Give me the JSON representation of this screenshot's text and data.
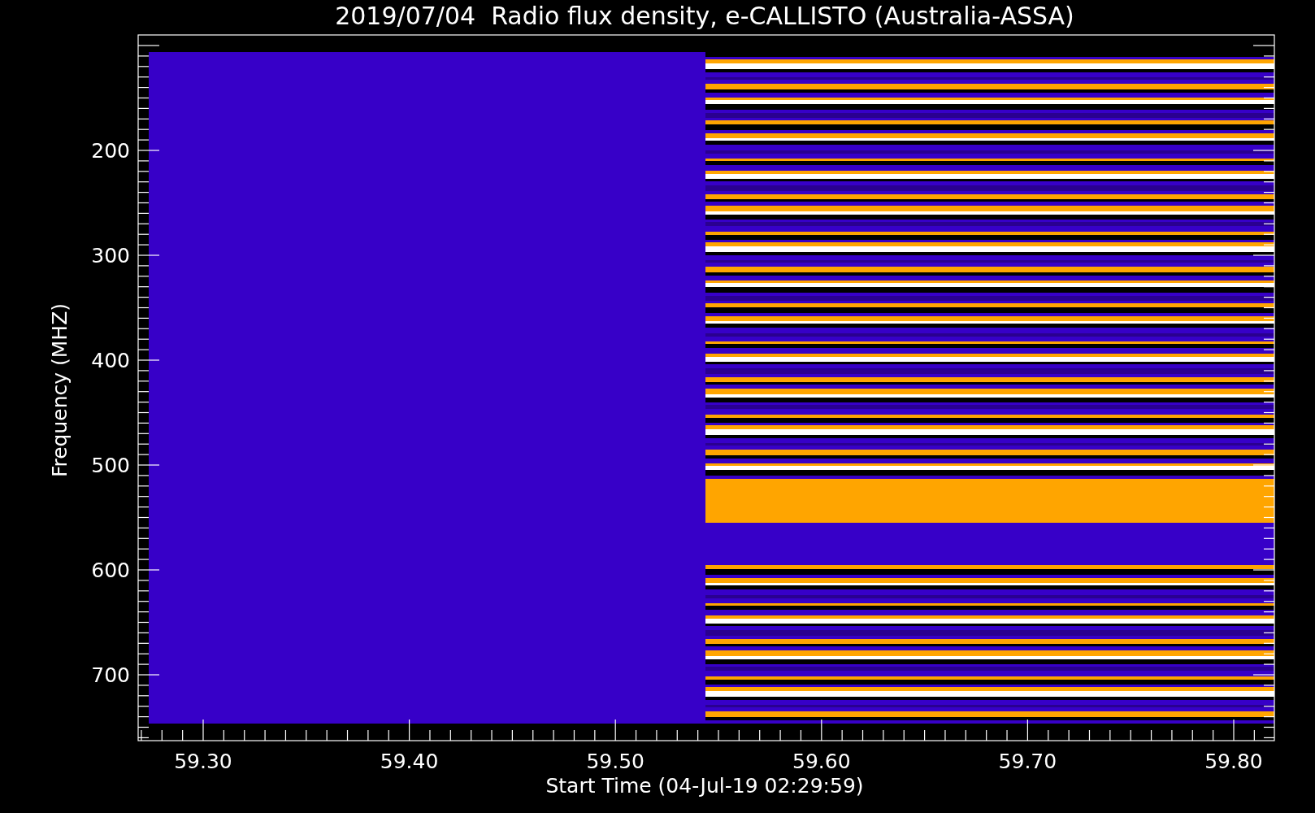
{
  "title": "2019/07/04  Radio flux density, e-CALLISTO (Australia-ASSA)",
  "y_axis": {
    "label": "Frequency (MHZ)",
    "ticks": [
      {
        "label": "200"
      },
      {
        "label": "300"
      },
      {
        "label": "400"
      },
      {
        "label": "500"
      },
      {
        "label": "600"
      },
      {
        "label": "700"
      }
    ]
  },
  "x_axis": {
    "label": "Start Time (04-Jul-19 02:29:59)",
    "ticks": [
      {
        "label": "59.30"
      },
      {
        "label": "59.40"
      },
      {
        "label": "59.50"
      },
      {
        "label": "59.60"
      },
      {
        "label": "59.70"
      },
      {
        "label": "59.80"
      }
    ]
  }
}
